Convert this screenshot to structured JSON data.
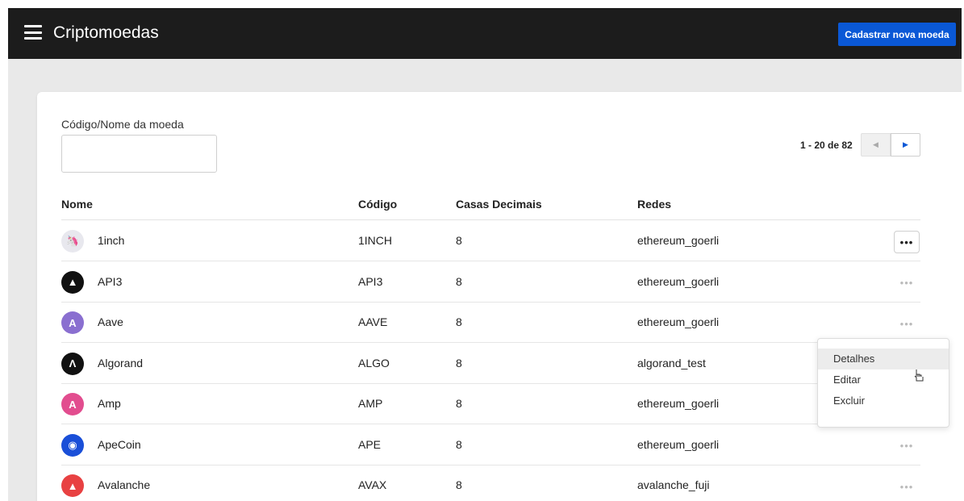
{
  "header": {
    "title": "Criptomoedas",
    "menu_icon": "hamburger-menu-icon",
    "cta_label": "Cadastrar nova moeda"
  },
  "filter": {
    "label": "Código/Nome da moeda",
    "value": "",
    "placeholder": ""
  },
  "pagination": {
    "range_text": "1 - 20 de 82",
    "prev_icon": "chevron-left-icon",
    "next_icon": "chevron-right-icon"
  },
  "table": {
    "headers": {
      "name": "Nome",
      "code": "Código",
      "decimals": "Casas Decimais",
      "networks": "Redes"
    },
    "rows": [
      {
        "name": "1inch",
        "code": "1INCH",
        "decimals": "8",
        "network": "ethereum_goerli",
        "icon": "1inch-logo-icon",
        "icon_color": "#e8e8ee",
        "icon_glyph": "🦄"
      },
      {
        "name": "API3",
        "code": "API3",
        "decimals": "8",
        "network": "ethereum_goerli",
        "icon": "api3-logo-icon",
        "icon_color": "#111111",
        "icon_glyph": "▲"
      },
      {
        "name": "Aave",
        "code": "AAVE",
        "decimals": "8",
        "network": "ethereum_goerli",
        "icon": "aave-logo-icon",
        "icon_color": "#8a6fd0",
        "icon_glyph": "A"
      },
      {
        "name": "Algorand",
        "code": "ALGO",
        "decimals": "8",
        "network": "algorand_test",
        "icon": "algorand-logo-icon",
        "icon_color": "#111111",
        "icon_glyph": "Λ"
      },
      {
        "name": "Amp",
        "code": "AMP",
        "decimals": "8",
        "network": "ethereum_goerli",
        "icon": "amp-logo-icon",
        "icon_color": "#e24d8f",
        "icon_glyph": "A"
      },
      {
        "name": "ApeCoin",
        "code": "APE",
        "decimals": "8",
        "network": "ethereum_goerli",
        "icon": "apecoin-logo-icon",
        "icon_color": "#1a4fd8",
        "icon_glyph": "◉"
      },
      {
        "name": "Avalanche",
        "code": "AVAX",
        "decimals": "8",
        "network": "avalanche_fuji",
        "icon": "avalanche-logo-icon",
        "icon_color": "#e84142",
        "icon_glyph": "▲"
      }
    ],
    "row_menu_glyph": "•••"
  },
  "row_menu": {
    "items": [
      "Detalhes",
      "Editar",
      "Excluir"
    ],
    "hovered": "Detalhes"
  },
  "colors": {
    "topbar": "#1c1c1c",
    "accent": "#0a58d6",
    "background": "#e9e9e9"
  }
}
